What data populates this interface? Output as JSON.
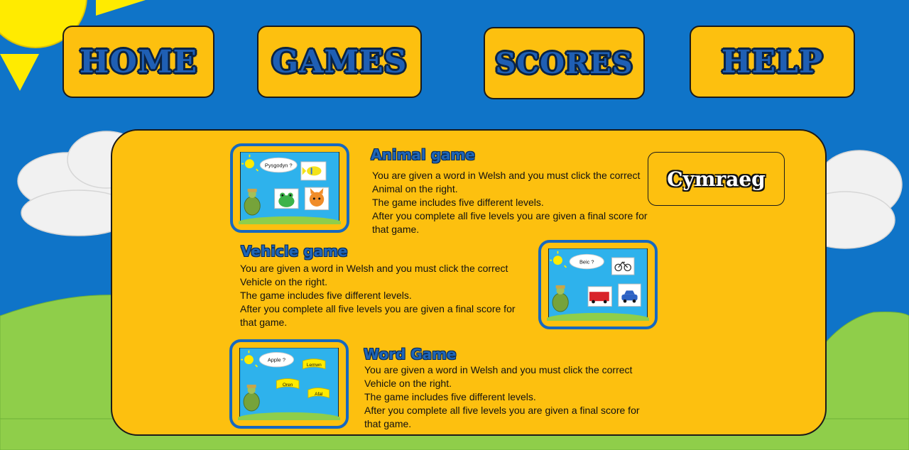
{
  "nav": {
    "home": "HOME",
    "games": "GAMES",
    "scores": "SCORES",
    "help": "HELP"
  },
  "language_button": "Cymraeg",
  "games": [
    {
      "title": "Animal game",
      "lines": [
        "You are given a word in Welsh and you must click the correct",
        "Animal on the right.",
        "The game includes five different levels.",
        "After you complete all five levels you are given a final score for",
        "that game."
      ],
      "preview_word": "Pysgodyn ?",
      "preview_icons": [
        "fish-icon",
        "frog-icon",
        "cat-icon"
      ]
    },
    {
      "title": "Vehicle game",
      "lines": [
        "You are given a word in Welsh and you must click the correct",
        "Vehicle on the right.",
        "The game includes five different levels.",
        "After you complete all five levels you are given a final score for",
        "that game."
      ],
      "preview_word": "Beic ?",
      "preview_icons": [
        "bicycle-icon",
        "bus-icon",
        "car-icon"
      ]
    },
    {
      "title": "Word Game",
      "lines": [
        "You are given a word in Welsh and you must click the correct",
        "Vehicle on the right.",
        "The game includes five different levels.",
        "After you complete all five levels you are given a final score for",
        "that game."
      ],
      "preview_word": "Apple ?",
      "preview_flags": [
        "Lemwn",
        "Oren",
        "Afal"
      ]
    }
  ],
  "colors": {
    "sky": "#0f74c8",
    "panel": "#fdc00f",
    "title_blue": "#1f66b8",
    "grass": "#8fce4a"
  }
}
